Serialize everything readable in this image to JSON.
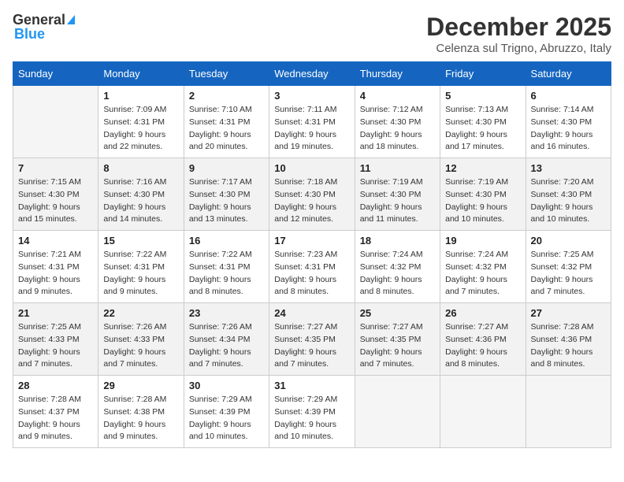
{
  "header": {
    "logo_line1": "General",
    "logo_line2": "Blue",
    "title": "December 2025",
    "subtitle": "Celenza sul Trigno, Abruzzo, Italy"
  },
  "columns": [
    "Sunday",
    "Monday",
    "Tuesday",
    "Wednesday",
    "Thursday",
    "Friday",
    "Saturday"
  ],
  "weeks": [
    [
      {
        "day": "",
        "empty": true
      },
      {
        "day": "1",
        "sunrise": "7:09 AM",
        "sunset": "4:31 PM",
        "daylight": "9 hours and 22 minutes."
      },
      {
        "day": "2",
        "sunrise": "7:10 AM",
        "sunset": "4:31 PM",
        "daylight": "9 hours and 20 minutes."
      },
      {
        "day": "3",
        "sunrise": "7:11 AM",
        "sunset": "4:31 PM",
        "daylight": "9 hours and 19 minutes."
      },
      {
        "day": "4",
        "sunrise": "7:12 AM",
        "sunset": "4:30 PM",
        "daylight": "9 hours and 18 minutes."
      },
      {
        "day": "5",
        "sunrise": "7:13 AM",
        "sunset": "4:30 PM",
        "daylight": "9 hours and 17 minutes."
      },
      {
        "day": "6",
        "sunrise": "7:14 AM",
        "sunset": "4:30 PM",
        "daylight": "9 hours and 16 minutes."
      }
    ],
    [
      {
        "day": "7",
        "sunrise": "7:15 AM",
        "sunset": "4:30 PM",
        "daylight": "9 hours and 15 minutes."
      },
      {
        "day": "8",
        "sunrise": "7:16 AM",
        "sunset": "4:30 PM",
        "daylight": "9 hours and 14 minutes."
      },
      {
        "day": "9",
        "sunrise": "7:17 AM",
        "sunset": "4:30 PM",
        "daylight": "9 hours and 13 minutes."
      },
      {
        "day": "10",
        "sunrise": "7:18 AM",
        "sunset": "4:30 PM",
        "daylight": "9 hours and 12 minutes."
      },
      {
        "day": "11",
        "sunrise": "7:19 AM",
        "sunset": "4:30 PM",
        "daylight": "9 hours and 11 minutes."
      },
      {
        "day": "12",
        "sunrise": "7:19 AM",
        "sunset": "4:30 PM",
        "daylight": "9 hours and 10 minutes."
      },
      {
        "day": "13",
        "sunrise": "7:20 AM",
        "sunset": "4:30 PM",
        "daylight": "9 hours and 10 minutes."
      }
    ],
    [
      {
        "day": "14",
        "sunrise": "7:21 AM",
        "sunset": "4:31 PM",
        "daylight": "9 hours and 9 minutes."
      },
      {
        "day": "15",
        "sunrise": "7:22 AM",
        "sunset": "4:31 PM",
        "daylight": "9 hours and 9 minutes."
      },
      {
        "day": "16",
        "sunrise": "7:22 AM",
        "sunset": "4:31 PM",
        "daylight": "9 hours and 8 minutes."
      },
      {
        "day": "17",
        "sunrise": "7:23 AM",
        "sunset": "4:31 PM",
        "daylight": "9 hours and 8 minutes."
      },
      {
        "day": "18",
        "sunrise": "7:24 AM",
        "sunset": "4:32 PM",
        "daylight": "9 hours and 8 minutes."
      },
      {
        "day": "19",
        "sunrise": "7:24 AM",
        "sunset": "4:32 PM",
        "daylight": "9 hours and 7 minutes."
      },
      {
        "day": "20",
        "sunrise": "7:25 AM",
        "sunset": "4:32 PM",
        "daylight": "9 hours and 7 minutes."
      }
    ],
    [
      {
        "day": "21",
        "sunrise": "7:25 AM",
        "sunset": "4:33 PM",
        "daylight": "9 hours and 7 minutes."
      },
      {
        "day": "22",
        "sunrise": "7:26 AM",
        "sunset": "4:33 PM",
        "daylight": "9 hours and 7 minutes."
      },
      {
        "day": "23",
        "sunrise": "7:26 AM",
        "sunset": "4:34 PM",
        "daylight": "9 hours and 7 minutes."
      },
      {
        "day": "24",
        "sunrise": "7:27 AM",
        "sunset": "4:35 PM",
        "daylight": "9 hours and 7 minutes."
      },
      {
        "day": "25",
        "sunrise": "7:27 AM",
        "sunset": "4:35 PM",
        "daylight": "9 hours and 7 minutes."
      },
      {
        "day": "26",
        "sunrise": "7:27 AM",
        "sunset": "4:36 PM",
        "daylight": "9 hours and 8 minutes."
      },
      {
        "day": "27",
        "sunrise": "7:28 AM",
        "sunset": "4:36 PM",
        "daylight": "9 hours and 8 minutes."
      }
    ],
    [
      {
        "day": "28",
        "sunrise": "7:28 AM",
        "sunset": "4:37 PM",
        "daylight": "9 hours and 9 minutes."
      },
      {
        "day": "29",
        "sunrise": "7:28 AM",
        "sunset": "4:38 PM",
        "daylight": "9 hours and 9 minutes."
      },
      {
        "day": "30",
        "sunrise": "7:29 AM",
        "sunset": "4:39 PM",
        "daylight": "9 hours and 10 minutes."
      },
      {
        "day": "31",
        "sunrise": "7:29 AM",
        "sunset": "4:39 PM",
        "daylight": "9 hours and 10 minutes."
      },
      {
        "day": "",
        "empty": true
      },
      {
        "day": "",
        "empty": true
      },
      {
        "day": "",
        "empty": true
      }
    ]
  ],
  "labels": {
    "sunrise": "Sunrise:",
    "sunset": "Sunset:",
    "daylight": "Daylight:"
  }
}
